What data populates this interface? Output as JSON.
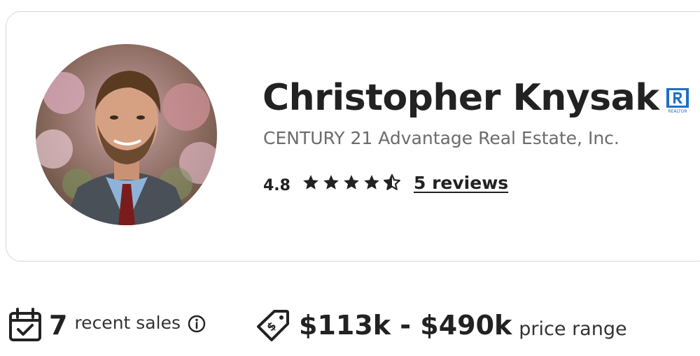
{
  "agent": {
    "name": "Christopher Knysak",
    "brokerage": "CENTURY 21 Advantage Real Estate, Inc.",
    "photo_icon": "agent-photo",
    "badge_icon": "realtor-icon",
    "badge_text": "REALTOR"
  },
  "rating": {
    "value": "4.8",
    "stars_filled": 4.5,
    "stars_total": 5,
    "reviews_label": "5 reviews"
  },
  "stats": {
    "sales": {
      "icon": "calendar-check-icon",
      "count": "7",
      "label": "recent sales",
      "info_icon": "info-icon"
    },
    "price": {
      "icon": "price-tag-icon",
      "range": "$113k - $490k",
      "label": "price range"
    }
  },
  "colors": {
    "text": "#222222",
    "muted": "#6b6b6b",
    "border": "#d8d8d8",
    "realtor_blue": "#1f6fc5"
  }
}
